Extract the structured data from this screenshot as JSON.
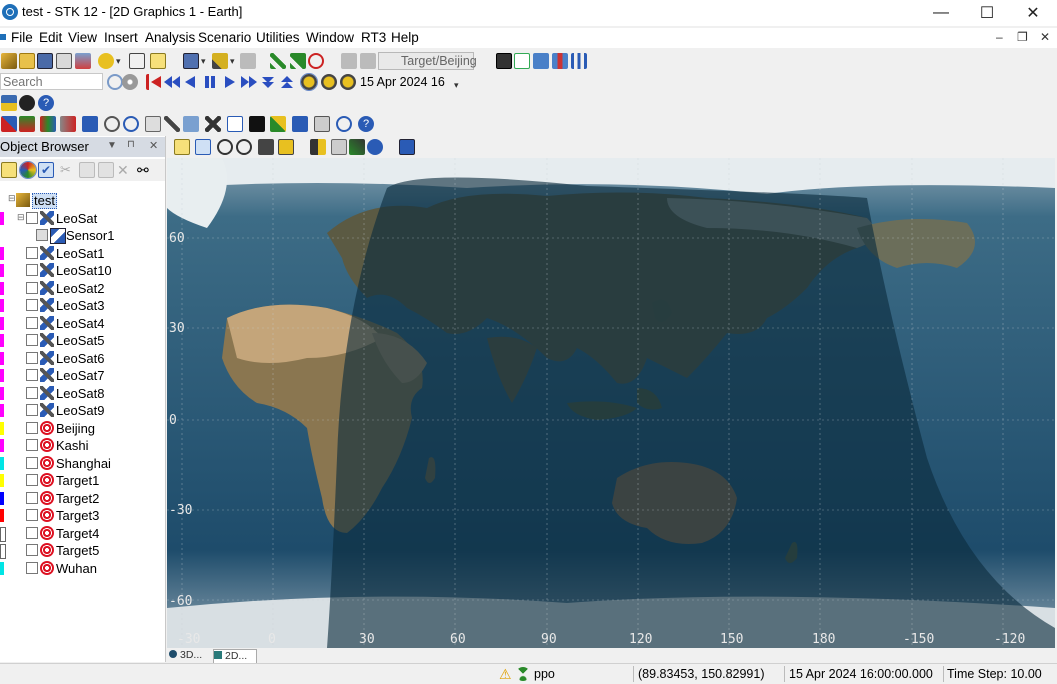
{
  "window": {
    "title": "test - STK 12 - [2D Graphics 1 - Earth]",
    "minimize": "—",
    "maximize": "☐",
    "close": "✕"
  },
  "menu": {
    "items": [
      "File",
      "Edit",
      "View",
      "Insert",
      "Analysis",
      "Scenario",
      "Utilities",
      "Window",
      "RT3",
      "Help"
    ],
    "mdi_min": "–",
    "mdi_restore": "❐",
    "mdi_close": "✕"
  },
  "toolbar": {
    "target_combo": "Target/Beijing",
    "search_placeholder": "Search",
    "date_field": "15 Apr 2024 16"
  },
  "object_browser": {
    "title": "Object Browser",
    "tree": [
      {
        "label": "test",
        "level": 0,
        "type": "scenario",
        "selected": true
      },
      {
        "label": "LeoSat",
        "level": 1,
        "type": "sat",
        "color": "#ff00ff"
      },
      {
        "label": "Sensor1",
        "level": 2,
        "type": "sensor"
      },
      {
        "label": "LeoSat1",
        "level": 1,
        "type": "sat",
        "color": "#ff00ff"
      },
      {
        "label": "LeoSat10",
        "level": 1,
        "type": "sat",
        "color": "#ff00ff"
      },
      {
        "label": "LeoSat2",
        "level": 1,
        "type": "sat",
        "color": "#ff00ff"
      },
      {
        "label": "LeoSat3",
        "level": 1,
        "type": "sat",
        "color": "#ff00ff"
      },
      {
        "label": "LeoSat4",
        "level": 1,
        "type": "sat",
        "color": "#ff00ff"
      },
      {
        "label": "LeoSat5",
        "level": 1,
        "type": "sat",
        "color": "#ff00ff"
      },
      {
        "label": "LeoSat6",
        "level": 1,
        "type": "sat",
        "color": "#ff00ff"
      },
      {
        "label": "LeoSat7",
        "level": 1,
        "type": "sat",
        "color": "#ff00ff"
      },
      {
        "label": "LeoSat8",
        "level": 1,
        "type": "sat",
        "color": "#ff00ff"
      },
      {
        "label": "LeoSat9",
        "level": 1,
        "type": "sat",
        "color": "#ff00ff"
      },
      {
        "label": "Beijing",
        "level": 1,
        "type": "target",
        "color": "#ffff00"
      },
      {
        "label": "Kashi",
        "level": 1,
        "type": "target",
        "color": "#ff00ff"
      },
      {
        "label": "Shanghai",
        "level": 1,
        "type": "target",
        "color": "#00e5e5"
      },
      {
        "label": "Target1",
        "level": 1,
        "type": "target",
        "color": "#ffff00"
      },
      {
        "label": "Target2",
        "level": 1,
        "type": "target",
        "color": "#0000ff"
      },
      {
        "label": "Target3",
        "level": 1,
        "type": "target",
        "color": "#ff0000"
      },
      {
        "label": "Target4",
        "level": 1,
        "type": "target",
        "color": "#ffffff"
      },
      {
        "label": "Target5",
        "level": 1,
        "type": "target",
        "color": "#ffffff"
      },
      {
        "label": "Wuhan",
        "level": 1,
        "type": "target",
        "color": "#00e5e5"
      }
    ]
  },
  "map": {
    "lat_labels": [
      "60",
      "30",
      "0",
      "-30",
      "-60"
    ],
    "lon_labels": [
      "-30",
      "0",
      "30",
      "60",
      "90",
      "120",
      "150",
      "180",
      "-150",
      "-120"
    ],
    "day_color": "#3f6b84",
    "night_color": "#0c2b3d"
  },
  "tabs": [
    "3D...",
    "2D..."
  ],
  "status": {
    "user": "ppo",
    "coords": "(89.83453, 150.82991)",
    "time": "15 Apr 2024 16:00:00.000",
    "step": "Time Step: 10.00"
  }
}
